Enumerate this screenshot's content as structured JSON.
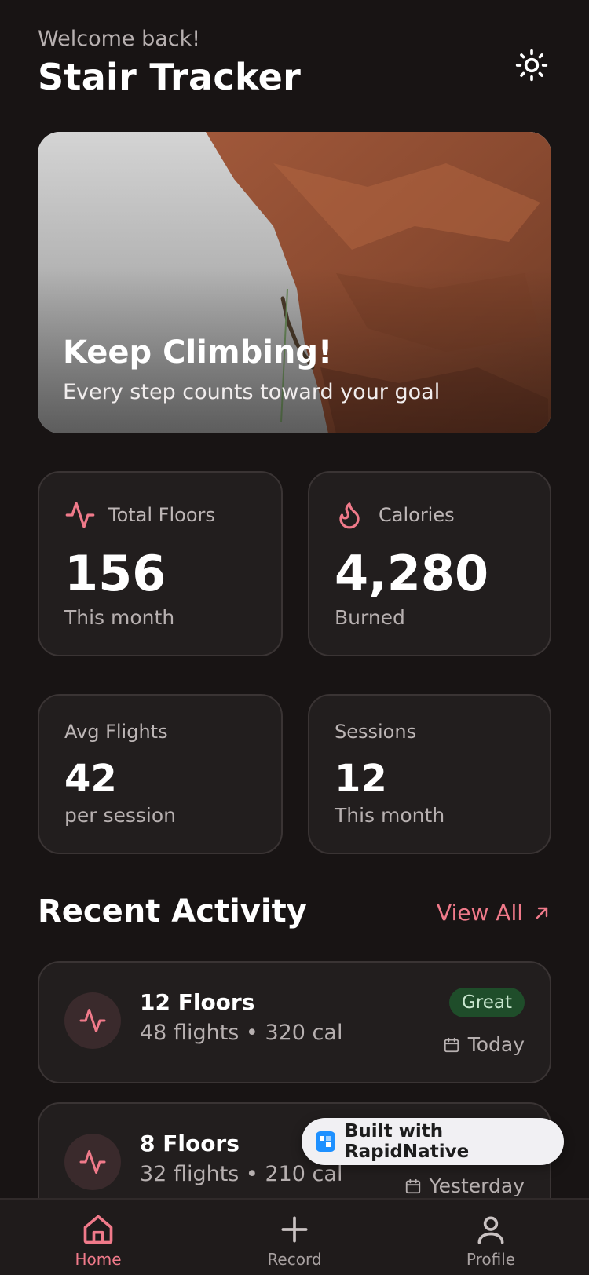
{
  "header": {
    "welcome": "Welcome back!",
    "title": "Stair Tracker",
    "theme_icon": "sun-icon"
  },
  "hero": {
    "title": "Keep Climbing!",
    "subtitle": "Every step counts toward your goal"
  },
  "stats": [
    {
      "label": "Total Floors",
      "value": "156",
      "sub": "This month",
      "icon": "activity-icon"
    },
    {
      "label": "Calories",
      "value": "4,280",
      "sub": "Burned",
      "icon": "flame-icon"
    },
    {
      "label": "Avg Flights",
      "value": "42",
      "sub": "per session"
    },
    {
      "label": "Sessions",
      "value": "12",
      "sub": "This month"
    }
  ],
  "recent": {
    "title": "Recent Activity",
    "view_all": "View All"
  },
  "activities": [
    {
      "title": "12 Floors",
      "sub": "48 flights • 320 cal",
      "badge": "Great",
      "date": "Today"
    },
    {
      "title": "8 Floors",
      "sub": "32 flights • 210 cal",
      "date": "Yesterday"
    }
  ],
  "rapidnative": {
    "label": "Built with RapidNative"
  },
  "tabs": [
    {
      "label": "Home",
      "icon": "home-icon"
    },
    {
      "label": "Record",
      "icon": "plus-icon"
    },
    {
      "label": "Profile",
      "icon": "user-icon"
    }
  ],
  "colors": {
    "background": "#181414",
    "card": "#221e1e",
    "accent": "#f07a8a",
    "badge_green": "#1f4d2a"
  }
}
